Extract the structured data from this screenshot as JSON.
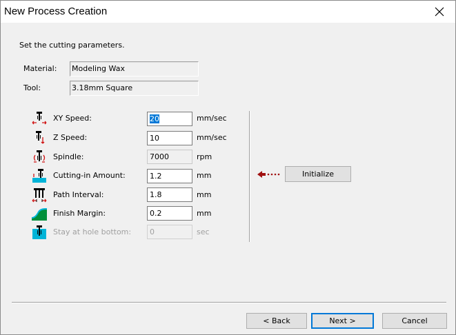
{
  "window": {
    "title": "New Process Creation"
  },
  "instructions": "Set the cutting parameters.",
  "info": {
    "material_label": "Material:",
    "material_value": "Modeling Wax",
    "tool_label": "Tool:",
    "tool_value": "3.18mm Square"
  },
  "params": [
    {
      "label": "XY Speed:",
      "value": "20",
      "unit": "mm/sec",
      "icon": "xy-speed-icon"
    },
    {
      "label": "Z Speed:",
      "value": "10",
      "unit": "mm/sec",
      "icon": "z-speed-icon"
    },
    {
      "label": "Spindle:",
      "value": "7000",
      "unit": "rpm",
      "icon": "spindle-icon"
    },
    {
      "label": "Cutting-in Amount:",
      "value": "1.2",
      "unit": "mm",
      "icon": "cutting-in-icon"
    },
    {
      "label": "Path Interval:",
      "value": "1.8",
      "unit": "mm",
      "icon": "path-interval-icon"
    },
    {
      "label": "Finish Margin:",
      "value": "0.2",
      "unit": "mm",
      "icon": "finish-margin-icon"
    },
    {
      "label": "Stay at hole bottom:",
      "value": "0",
      "unit": "sec",
      "icon": "hole-bottom-icon"
    }
  ],
  "buttons": {
    "initialize": "Initialize",
    "back": "< Back",
    "next": "Next >",
    "cancel": "Cancel"
  },
  "colors": {
    "accent": "#0078d7",
    "icon_cyan": "#00b4d8",
    "icon_red": "#d01010",
    "arrow_red": "#a01010"
  }
}
